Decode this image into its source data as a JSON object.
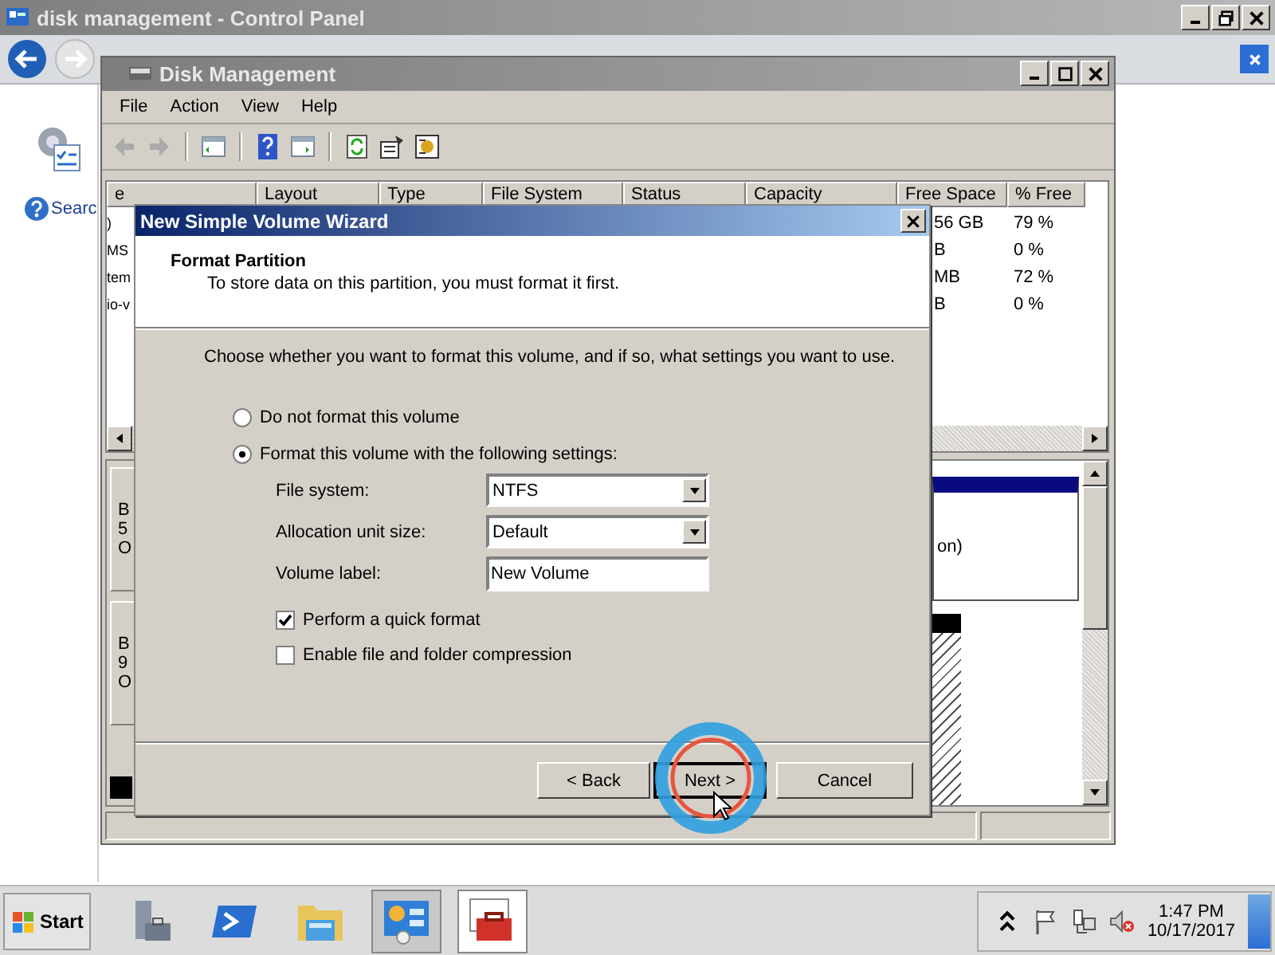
{
  "control_panel": {
    "title": "disk management - Control Panel",
    "search_link": "Searc"
  },
  "disk_management": {
    "title": "Disk Management",
    "menu": [
      "File",
      "Action",
      "View",
      "Help"
    ],
    "columns": [
      "e",
      "Layout",
      "Type",
      "File System",
      "Status",
      "Capacity",
      "Free Space",
      "% Free"
    ],
    "rows": [
      {
        "volume": ")",
        "free_space": "56 GB",
        "percent_free": "79 %"
      },
      {
        "volume": "MS",
        "free_space": "B",
        "percent_free": "0 %"
      },
      {
        "volume": "tem",
        "free_space": "MB",
        "percent_free": "72 %"
      },
      {
        "volume": "io-v",
        "free_space": "B",
        "percent_free": "0 %"
      }
    ],
    "disks": [
      {
        "lines": [
          "B",
          "5",
          "O"
        ]
      },
      {
        "lines": [
          "B",
          "9",
          "O"
        ]
      }
    ],
    "partition_text": "on)"
  },
  "wizard": {
    "title": "New Simple Volume Wizard",
    "heading": "Format Partition",
    "subheading": "To store data on this partition, you must format it first.",
    "instruction": "Choose whether you want to format this volume, and if so, what settings you want to use.",
    "options": [
      {
        "label": "Do not format this volume",
        "selected": false
      },
      {
        "label": "Format this volume with the following settings:",
        "selected": true
      }
    ],
    "settings": [
      {
        "kind": "dropdown",
        "label": "File system:",
        "value": "NTFS"
      },
      {
        "kind": "dropdown",
        "label": "Allocation unit size:",
        "value": "Default"
      },
      {
        "kind": "text",
        "label": "Volume label:",
        "value": "New Volume"
      }
    ],
    "checkboxes": [
      {
        "label": "Perform a quick format",
        "checked": true
      },
      {
        "label": "Enable file and folder compression",
        "checked": false
      }
    ],
    "buttons": [
      {
        "label": "< Back",
        "selected": false
      },
      {
        "label": "Next >",
        "selected": true
      },
      {
        "label": "Cancel",
        "selected": false
      }
    ]
  },
  "taskbar": {
    "start": "Start",
    "apps": [
      {
        "kind": "server",
        "selected": false
      },
      {
        "kind": "powershell",
        "selected": false
      },
      {
        "kind": "explorer",
        "selected": false
      },
      {
        "kind": "control-panel",
        "selected": true
      },
      {
        "kind": "toolbox",
        "selected": true
      }
    ],
    "time": "1:47 PM",
    "date": "10/17/2017"
  }
}
